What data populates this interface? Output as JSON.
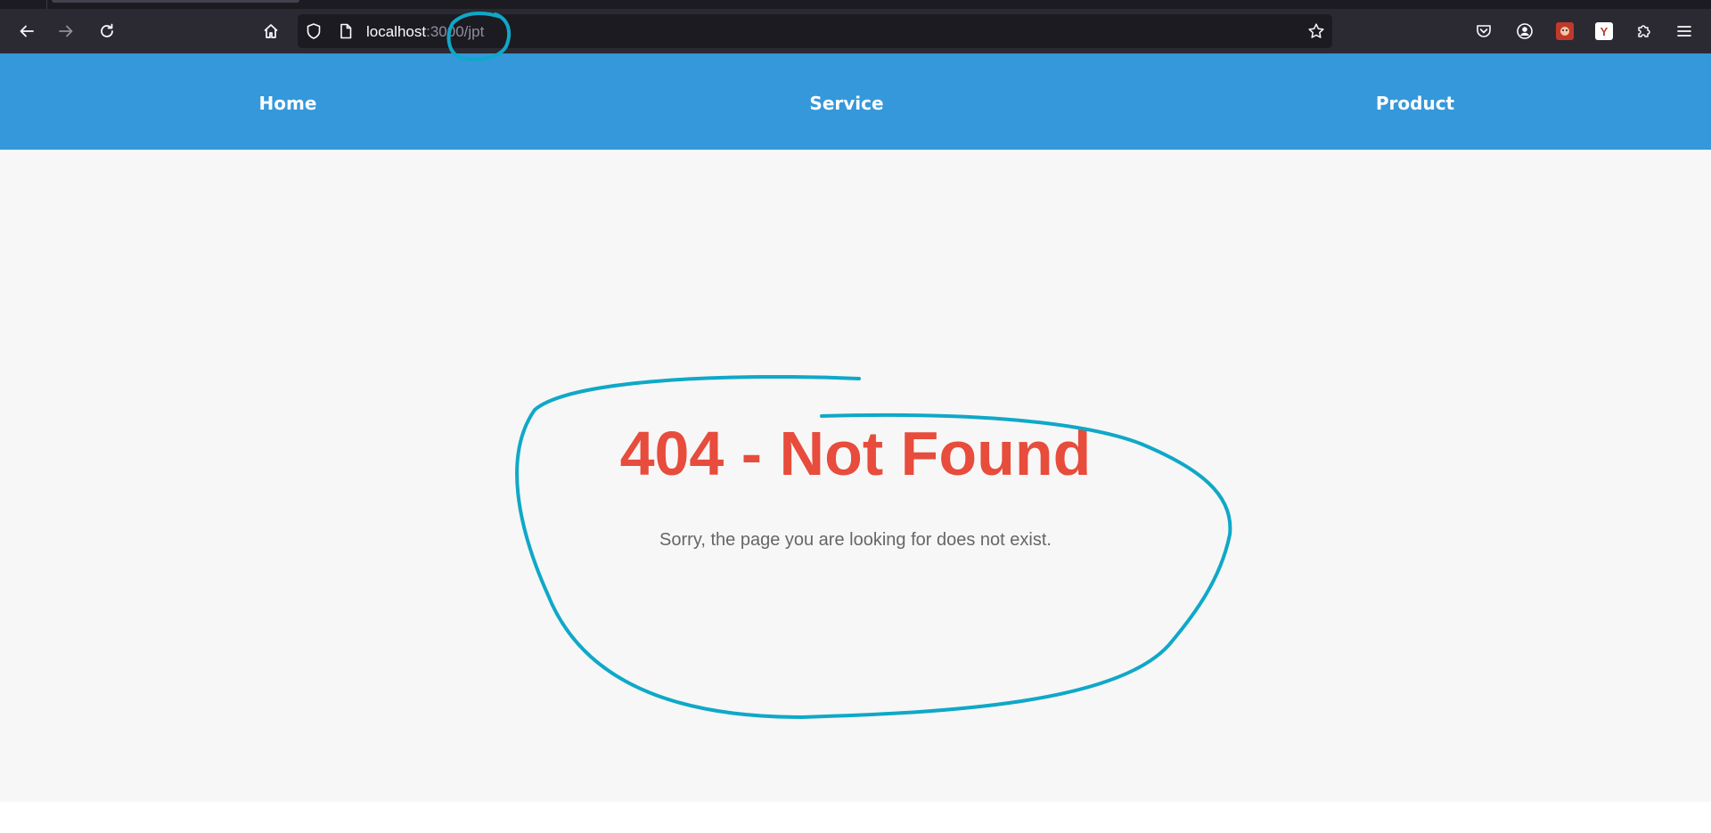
{
  "browser": {
    "url_host": "localhost",
    "url_path": ":3000/jpt"
  },
  "nav": {
    "home": "Home",
    "service": "Service",
    "product": "Product"
  },
  "error": {
    "title": "404 - Not Found",
    "message": "Sorry, the page you are looking for does not exist."
  },
  "icons": {
    "back": "arrow-left-icon",
    "forward": "arrow-right-icon",
    "reload": "reload-icon",
    "home": "home-icon",
    "tracking_protection": "shield-icon",
    "page": "page-icon",
    "bookmark": "star-icon",
    "pocket": "pocket-icon",
    "account": "account-icon",
    "extensions": "puzzle-icon",
    "menu": "hamburger-menu-icon"
  },
  "extensions": {
    "ext2_label": "Y"
  },
  "colors": {
    "navbar": "#3498db",
    "error_title": "#e74c3c",
    "annotation": "#0fa8c8",
    "browser_chrome": "#2b2a33"
  }
}
